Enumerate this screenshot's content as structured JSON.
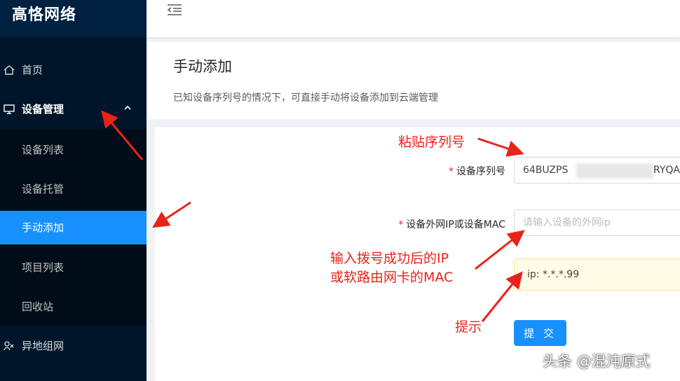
{
  "sidebar": {
    "logo": "高恪网络",
    "menu": [
      {
        "label": "首页",
        "icon": "home-icon"
      },
      {
        "label": "设备管理",
        "icon": "monitor-icon"
      },
      {
        "label": "异地组网",
        "icon": "network-icon"
      }
    ],
    "submenu": [
      {
        "label": "设备列表"
      },
      {
        "label": "设备托管"
      },
      {
        "label": "手动添加"
      },
      {
        "label": "项目列表"
      },
      {
        "label": "回收站"
      }
    ]
  },
  "header": {
    "title": "手动添加",
    "description": "已知设备序列号的情况下，可直接手动将设备添加到云端管理"
  },
  "form": {
    "serial_label": "设备序列号",
    "serial_value_start": "64BUZPS",
    "serial_value_end": "RYQA",
    "ip_label": "设备外网IP或设备MAC",
    "ip_placeholder": "请输入设备的外网ip",
    "required_mark": "*",
    "tip": "ip: *.*.*.99",
    "submit_label": "提 交"
  },
  "annotations": {
    "paste_serial": "粘贴序列号",
    "input_ip_line1": "输入拨号成功后的IP",
    "input_ip_line2": "或软路由网卡的MAC",
    "hint": "提示",
    "color": "#e8231a"
  },
  "watermark": "头条 @混沌原式"
}
